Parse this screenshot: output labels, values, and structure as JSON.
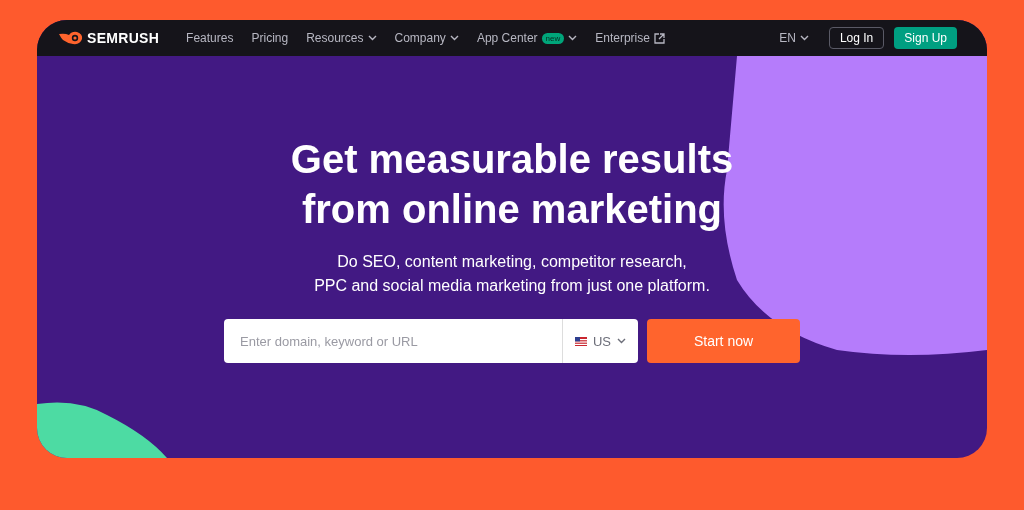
{
  "brand": {
    "name": "SEMRUSH"
  },
  "nav": [
    {
      "label": "Features",
      "kind": "link"
    },
    {
      "label": "Pricing",
      "kind": "link"
    },
    {
      "label": "Resources",
      "kind": "dropdown"
    },
    {
      "label": "Company",
      "kind": "dropdown"
    },
    {
      "label": "App Center",
      "kind": "dropdown",
      "badge": "new"
    },
    {
      "label": "Enterprise",
      "kind": "external"
    }
  ],
  "language": {
    "label": "EN"
  },
  "auth": {
    "login": "Log In",
    "signup": "Sign Up"
  },
  "hero": {
    "title_lines": [
      "Get measurable results",
      "from online marketing"
    ],
    "subtitle_lines": [
      "Do SEO, content marketing, competitor research,",
      "PPC and social media marketing from just one platform."
    ],
    "search": {
      "placeholder": "Enter domain, keyword or URL"
    },
    "country": {
      "label": "US"
    },
    "cta": "Start now"
  }
}
